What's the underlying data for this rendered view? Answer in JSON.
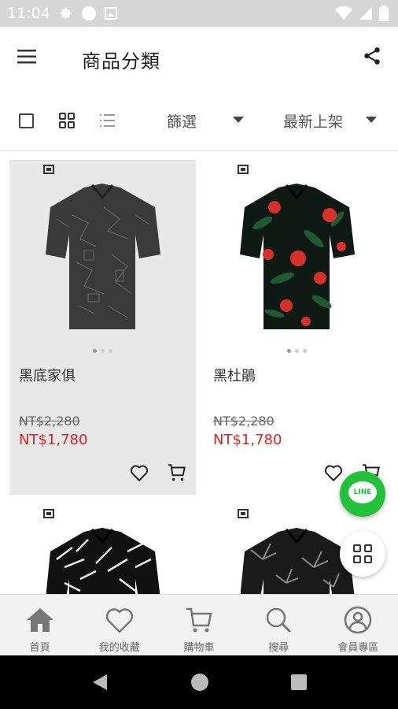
{
  "status_bar": {
    "time": "11:04"
  },
  "app_bar": {
    "title": "商品分類"
  },
  "filter_bar": {
    "filter_label": "篩選",
    "sort_label": "最新上架"
  },
  "products": [
    {
      "name": "黑底家俱",
      "original_price": "NT$2,280",
      "sale_price": "NT$1,780",
      "pattern": "dark-abstract"
    },
    {
      "name": "黑杜鵑",
      "original_price": "NT$2,280",
      "sale_price": "NT$1,780",
      "pattern": "red-hibiscus-tropical"
    },
    {
      "name": "",
      "pattern": "white-palm-leaves"
    },
    {
      "name": "",
      "pattern": "grey-cannabis-leaves"
    }
  ],
  "fab": {
    "line_label": "LINE"
  },
  "bottom_nav": {
    "items": [
      {
        "label": "首頁",
        "icon": "home-icon"
      },
      {
        "label": "我的收藏",
        "icon": "heart-icon"
      },
      {
        "label": "購物車",
        "icon": "cart-icon"
      },
      {
        "label": "搜尋",
        "icon": "search-icon"
      },
      {
        "label": "會員專區",
        "icon": "user-icon"
      }
    ]
  },
  "colors": {
    "sale_price": "#e02020",
    "line_green": "#22c13a",
    "selected_card_bg": "#e8e8e8"
  }
}
